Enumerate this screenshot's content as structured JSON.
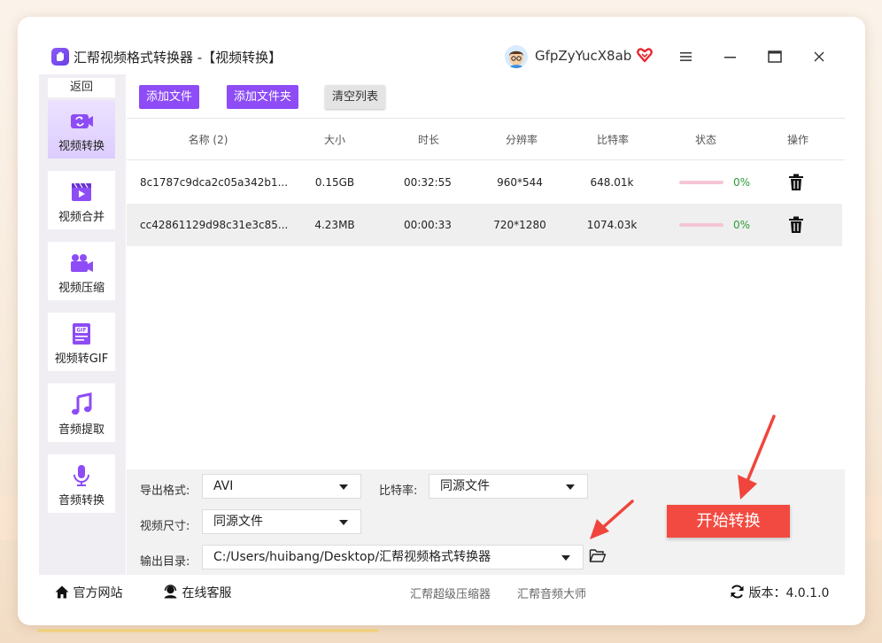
{
  "window": {
    "title": "汇帮视频格式转换器 -【视频转换】",
    "username": "GfpZyYucX8ab"
  },
  "sidebar": {
    "back_label": "返回",
    "items": [
      {
        "label": "视频转换",
        "icon": "video-convert-icon",
        "active": true
      },
      {
        "label": "视频合并",
        "icon": "video-merge-icon"
      },
      {
        "label": "视频压缩",
        "icon": "video-compress-icon"
      },
      {
        "label": "视频转GIF",
        "icon": "gif-icon"
      },
      {
        "label": "音频提取",
        "icon": "music-note-icon"
      },
      {
        "label": "音频转换",
        "icon": "microphone-icon"
      }
    ]
  },
  "toolbar": {
    "add_file": "添加文件",
    "add_folder": "添加文件夹",
    "clear_list": "清空列表"
  },
  "table": {
    "columns": [
      "名称 (2)",
      "大小",
      "时长",
      "分辨率",
      "比特率",
      "状态",
      "操作"
    ],
    "rows": [
      {
        "name": "8c1787c9dca2c05a342b1...",
        "size": "0.15GB",
        "duration": "00:32:55",
        "resolution": "960*544",
        "bitrate": "648.01k",
        "progress": 0,
        "status": "0%"
      },
      {
        "name": "cc42861129d98c31e3c85...",
        "size": "4.23MB",
        "duration": "00:00:33",
        "resolution": "720*1280",
        "bitrate": "1074.03k",
        "progress": 0,
        "status": "0%"
      }
    ]
  },
  "settings": {
    "format_label": "导出格式:",
    "format_value": "AVI",
    "bitrate_label": "比特率:",
    "bitrate_value": "同源文件",
    "size_label": "视频尺寸:",
    "size_value": "同源文件",
    "output_label": "输出目录:",
    "output_value": "C:/Users/huibang/Desktop/汇帮视频格式转换器",
    "start_button": "开始转换"
  },
  "footer": {
    "website": "官方网站",
    "support": "在线客服",
    "link1": "汇帮超级压缩器",
    "link2": "汇帮音频大师",
    "version": "版本：4.0.1.0"
  },
  "colors": {
    "accent": "#8d4cf6",
    "start": "#f24a40",
    "arrow": "#f0453c",
    "progress_track": "#f5c6d4",
    "status_text": "#2f9b38"
  }
}
